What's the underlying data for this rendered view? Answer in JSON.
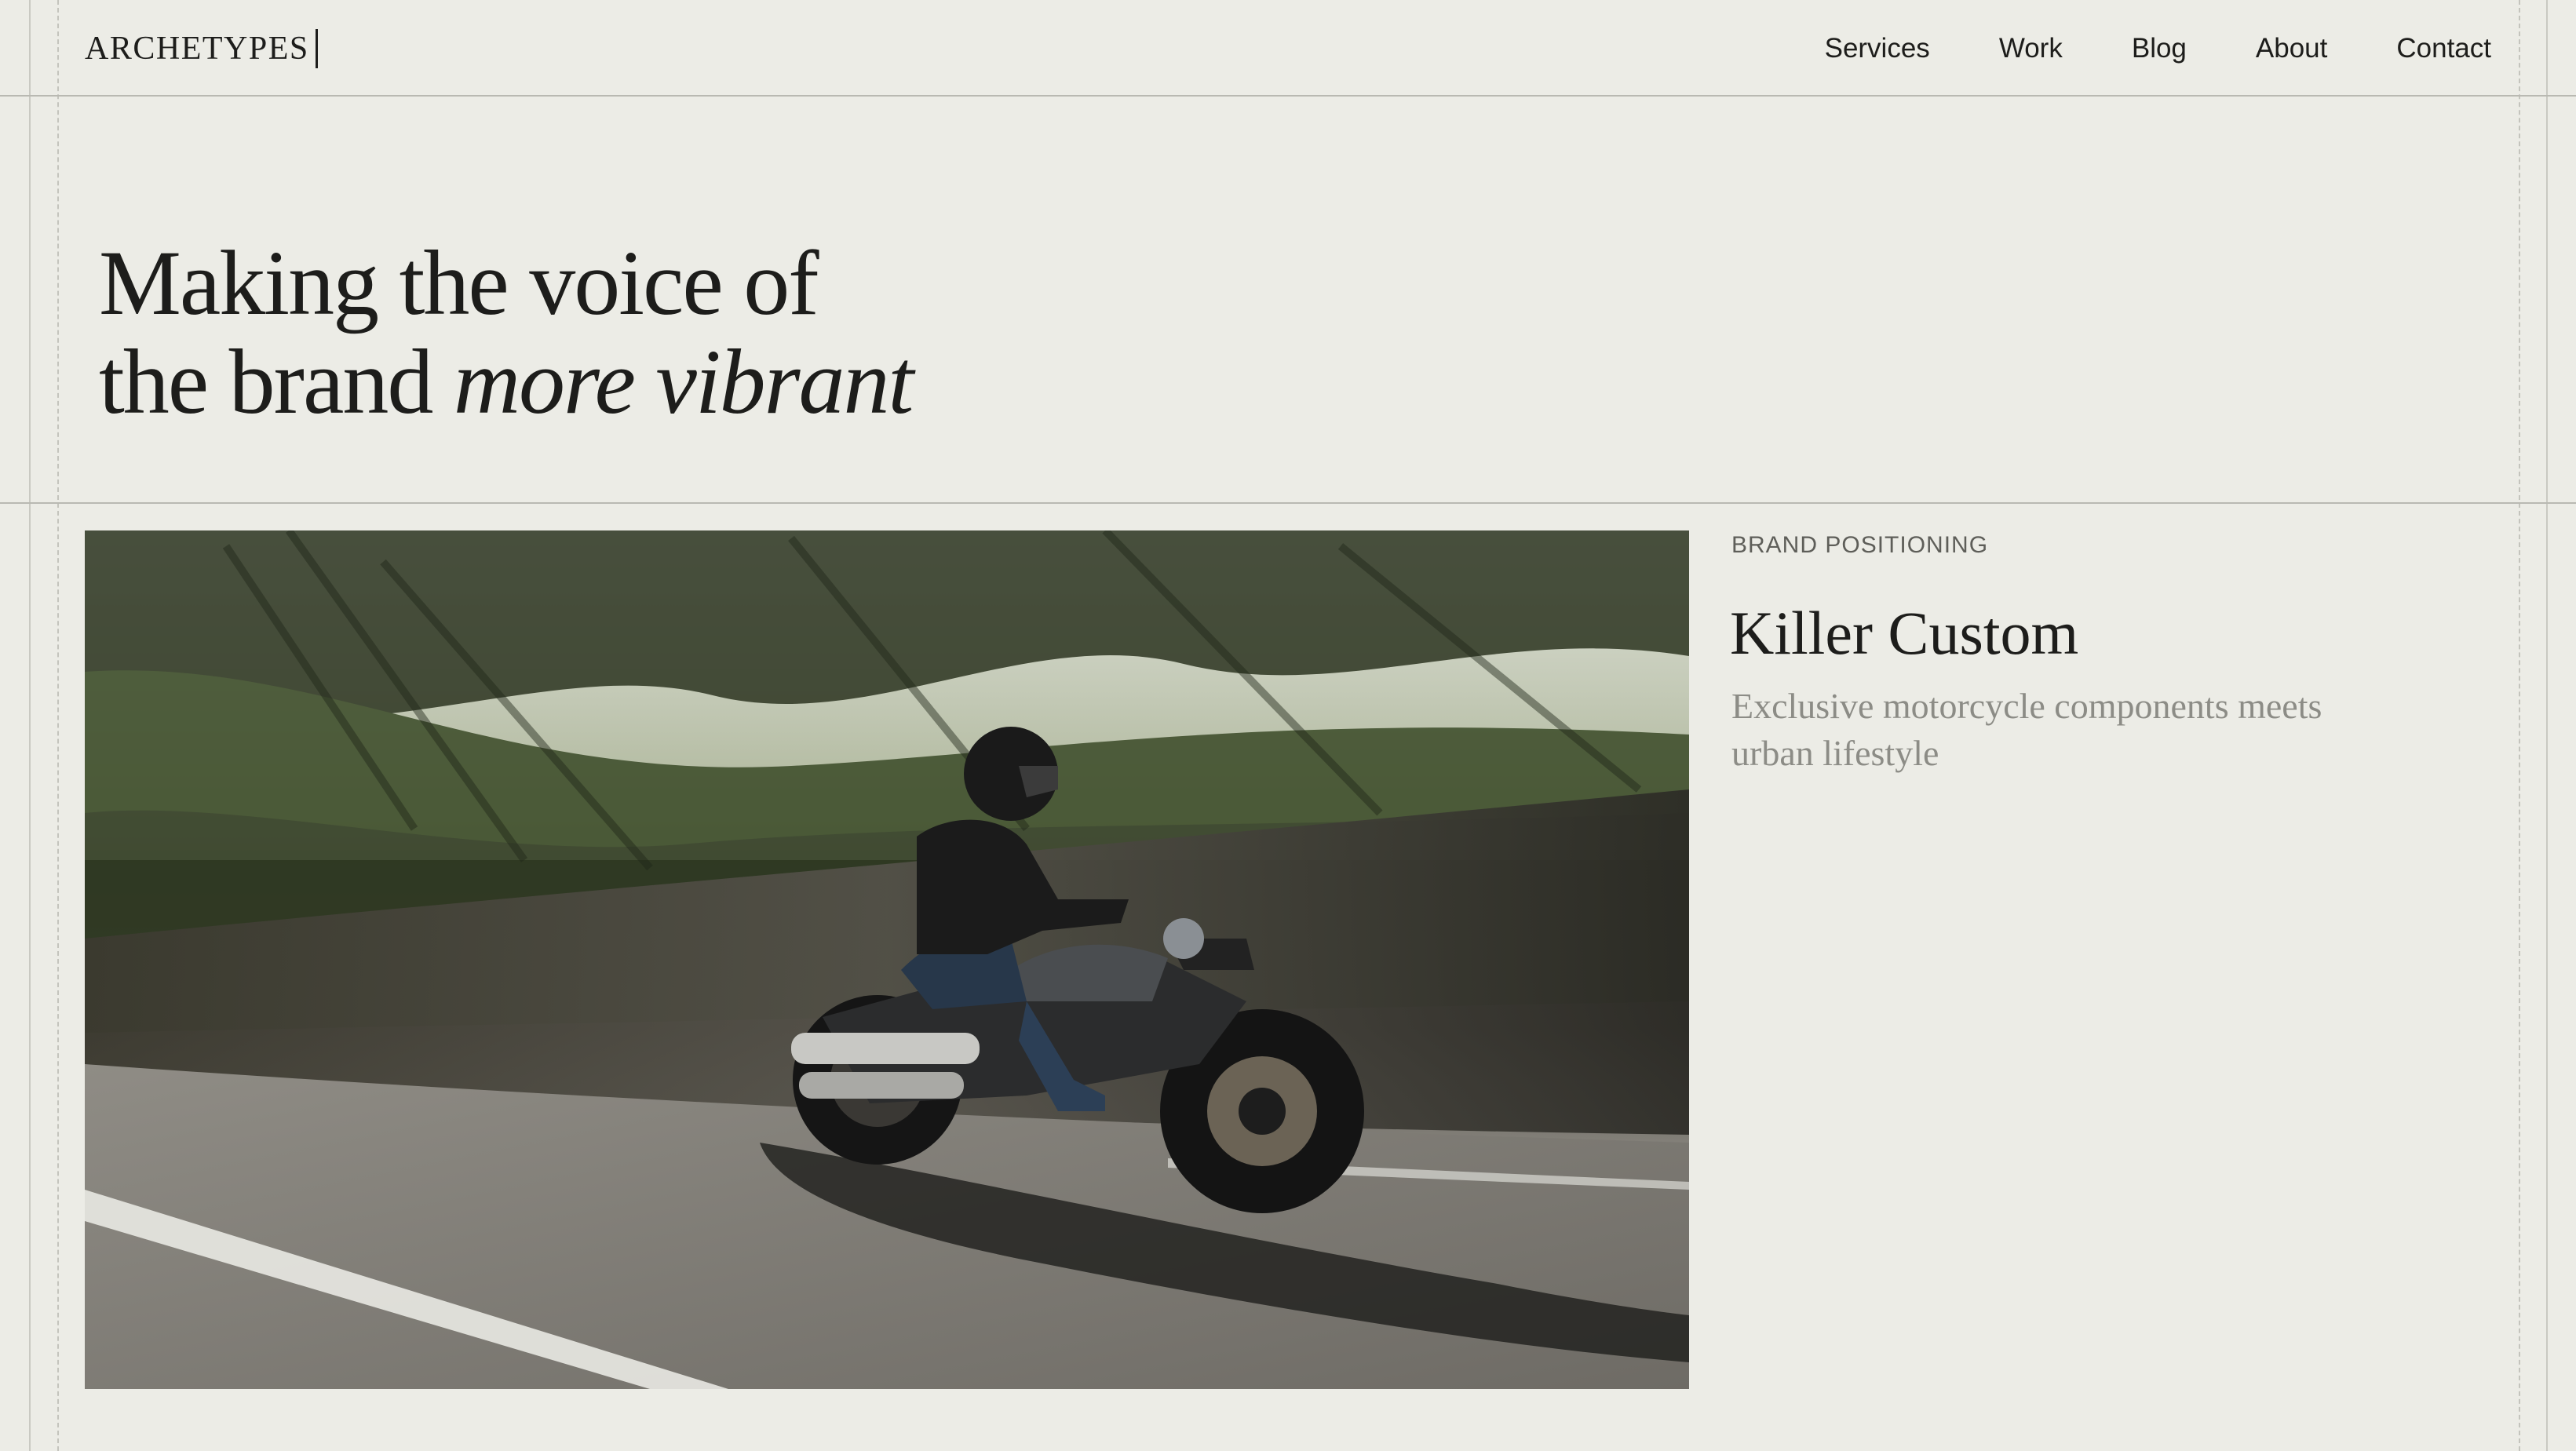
{
  "header": {
    "logo": "ARCHETYPES",
    "nav": [
      {
        "label": "Services"
      },
      {
        "label": "Work"
      },
      {
        "label": "Blog"
      },
      {
        "label": "About"
      },
      {
        "label": "Contact"
      }
    ]
  },
  "hero": {
    "line1": "Making the voice of",
    "line2_plain": "the brand ",
    "line2_italic": "more vibrant"
  },
  "feature": {
    "image_subject": "motorcycle-rider-photo",
    "category": "BRAND POSITIONING",
    "title": "Killer Custom",
    "description": "Exclusive motorcycle components meets urban lifestyle"
  },
  "colors": {
    "background": "#ecece6",
    "text": "#1d1d1b",
    "muted_text": "#8c8c86",
    "category_text": "#5e5e59",
    "rule": "#b9b9b2"
  }
}
